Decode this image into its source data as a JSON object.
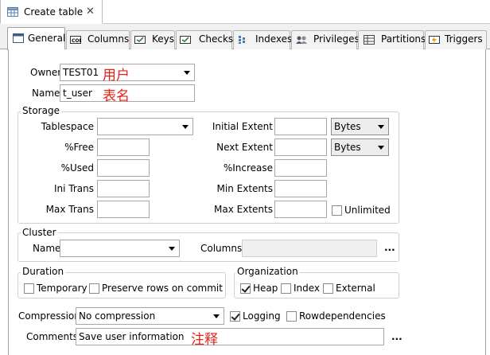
{
  "window_tab": {
    "title": "Create table",
    "close": "✕"
  },
  "tabs": [
    {
      "label": "General",
      "icon": "general-icon"
    },
    {
      "label": "Columns",
      "icon": "columns-icon"
    },
    {
      "label": "Keys",
      "icon": "keys-icon"
    },
    {
      "label": "Checks",
      "icon": "checks-icon"
    },
    {
      "label": "Indexes",
      "icon": "indexes-icon"
    },
    {
      "label": "Privileges",
      "icon": "privileges-icon"
    },
    {
      "label": "Partitions",
      "icon": "partitions-icon"
    },
    {
      "label": "Triggers",
      "icon": "triggers-icon"
    }
  ],
  "owner": {
    "label": "Owner",
    "value": "TEST01",
    "note": "用户"
  },
  "name": {
    "label": "Name",
    "value": "t_user",
    "note": "表名"
  },
  "storage": {
    "title": "Storage",
    "tablespace": "Tablespace",
    "free": "%Free",
    "used": "%Used",
    "ini_trans": "Ini Trans",
    "max_trans": "Max Trans",
    "initial_extent": "Initial Extent",
    "next_extent": "Next Extent",
    "increase": "%Increase",
    "min_extents": "Min Extents",
    "max_extents": "Max Extents",
    "unit": "Bytes",
    "unlimited": "Unlimited"
  },
  "cluster": {
    "title": "Cluster",
    "name": "Name",
    "columns": "Columns",
    "ellipsis": "..."
  },
  "duration": {
    "title": "Duration",
    "temporary": "Temporary",
    "preserve": "Preserve rows on commit"
  },
  "organization": {
    "title": "Organization",
    "heap": "Heap",
    "index": "Index",
    "external": "External",
    "heap_checked": true
  },
  "compression": {
    "label": "Compression",
    "value": "No compression"
  },
  "logging": {
    "label": "Logging",
    "checked": true
  },
  "rowdependencies": {
    "label": "Rowdependencies",
    "checked": false
  },
  "comments": {
    "label": "Comments",
    "value": "Save user information",
    "note": "注释",
    "ellipsis": "..."
  }
}
